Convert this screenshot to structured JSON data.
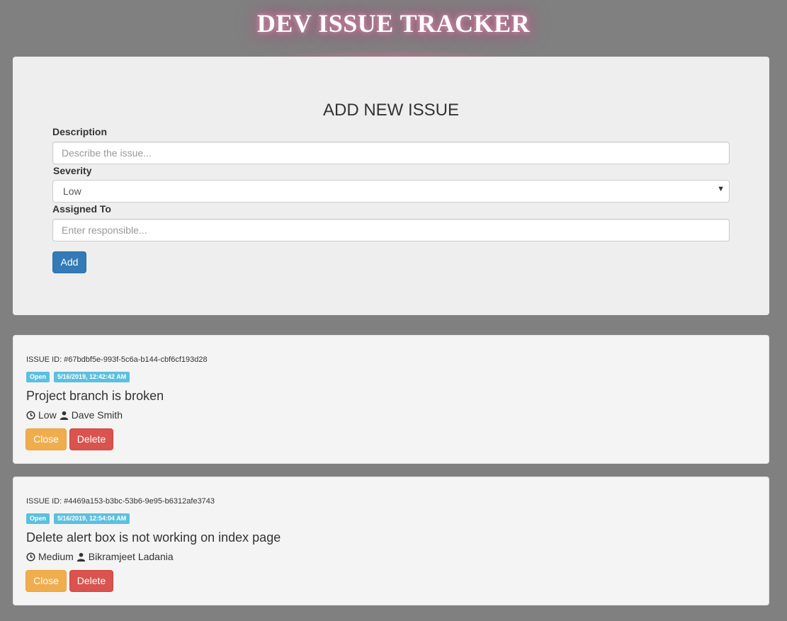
{
  "app": {
    "title": "DEV ISSUE TRACKER"
  },
  "form": {
    "heading": "ADD NEW ISSUE",
    "description": {
      "label": "Description",
      "placeholder": "Describe the issue...",
      "value": ""
    },
    "severity": {
      "label": "Severity",
      "selected": "Low"
    },
    "assigned_to": {
      "label": "Assigned To",
      "placeholder": "Enter responsible...",
      "value": ""
    },
    "add_label": "Add"
  },
  "issues": [
    {
      "id_text": "ISSUE ID: #67bdbf5e-993f-5c6a-b144-cbf6cf193d28",
      "status": "Open",
      "timestamp": "5/16/2019, 12:42:42 AM",
      "description": "Project branch is broken",
      "severity": "Low",
      "assignee": "Dave Smith",
      "close_label": "Close",
      "delete_label": "Delete"
    },
    {
      "id_text": "ISSUE ID: #4469a153-b3bc-53b6-9e95-b6312afe3743",
      "status": "Open",
      "timestamp": "5/16/2019, 12:54:04 AM",
      "description": "Delete alert box is not working on index page",
      "severity": "Medium",
      "assignee": "Bikramjeet Ladania",
      "close_label": "Close",
      "delete_label": "Delete"
    }
  ],
  "icons": {
    "severity": "clock-icon",
    "assignee": "user-icon",
    "select": "chevron-down-icon"
  },
  "colors": {
    "background": "#808080",
    "panel": "#eeeeee",
    "card": "#f4f4f4",
    "primary": "#337ab7",
    "warning": "#f0ad4e",
    "danger": "#d9534f",
    "info": "#5bc0de",
    "title_glow": "#c05080"
  }
}
